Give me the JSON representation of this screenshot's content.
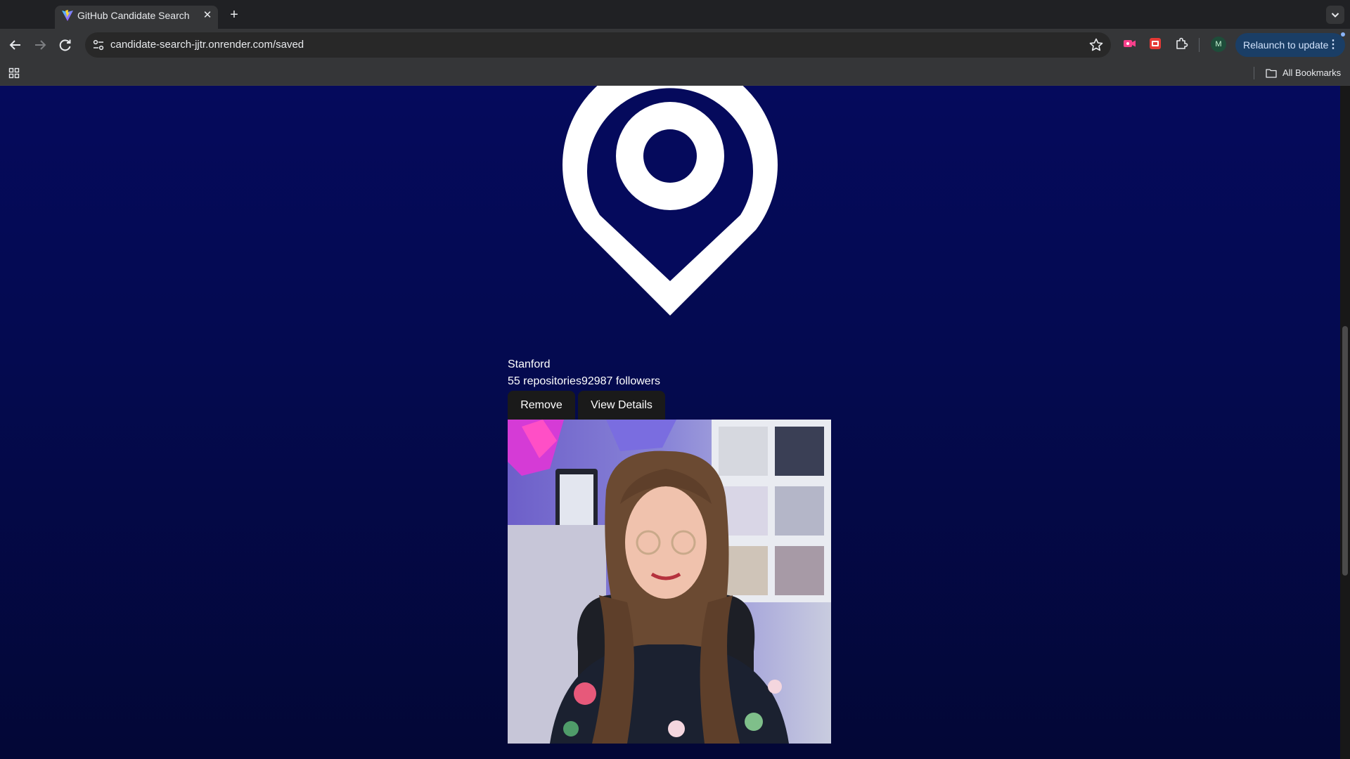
{
  "browser": {
    "tab_title": "GitHub Candidate Search",
    "url": "candidate-search-jjtr.onrender.com/saved",
    "profile_initial": "M",
    "relaunch_label": "Relaunch to update",
    "bookmarks_label": "All Bookmarks"
  },
  "candidate": {
    "location": "Stanford",
    "stats": "55 repositories92987 followers",
    "remove_label": "Remove",
    "view_details_label": "View Details"
  },
  "colors": {
    "page_top": "#050a5c",
    "page_bottom": "#030736",
    "button_bg": "#1a1a1a",
    "relaunch_bg": "#1a3e66"
  }
}
